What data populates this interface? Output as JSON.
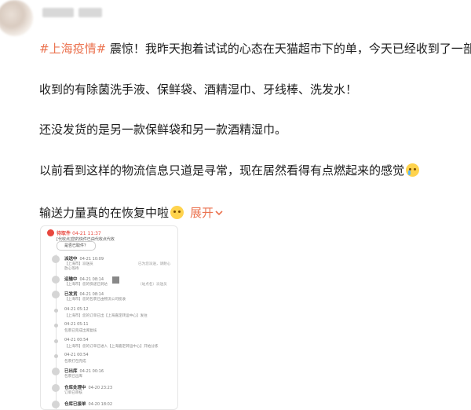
{
  "post": {
    "hashtag": "#上海疫情#",
    "line1_rest": " 震惊！我昨天抱着试试的心态在天猫超市下的单，今天已经收到了一部分",
    "line2": "收到的有除菌洗手液、保鲜袋、酒精湿巾、牙线棒、洗发水！",
    "line3": "还没发货的是另一款保鲜袋和另一款酒精湿巾。",
    "line4": "以前看到这样的物流信息只道是寻常，现在居然看得有点燃起来的感觉",
    "line5": "输送力量真的在恢复中啦",
    "expand_label": "展开",
    "expand_icon": "chevron-down-icon"
  },
  "tracking": {
    "status": "待取件",
    "status_time": "04-21 11:37",
    "status_note": "[代收点]您的快件已由代收点代收",
    "pickup_button": "是否已取件？",
    "events": [
      {
        "title": "派送中",
        "time": "04-21 10:09",
        "desc": "【上海市】派送员",
        "desc2": "放心等待",
        "right": "已为您派送，请耐心"
      },
      {
        "title": "运输中",
        "time": "04-21 08:14",
        "desc": "【上海市】您的快递已到达",
        "right": "（站点名）派送员"
      },
      {
        "title": "已发货",
        "time": "04-21 08:14",
        "desc": "【上海市】您的包裹已由物流公司揽收"
      },
      {
        "title": "",
        "time": "04-21 05:12",
        "desc": "【上海市】您的订单已出【上海嘉定转运中心】发往"
      },
      {
        "title": "",
        "time": "04-21 05:11",
        "desc": "包裹已完成出库复核"
      },
      {
        "title": "",
        "time": "04-21 00:54",
        "desc": "【上海市】您的订单已进入【上海嘉定转运中心】开始分拣"
      },
      {
        "title": "",
        "time": "04-21 00:54",
        "desc": "包裹打包完成"
      },
      {
        "title": "已出库",
        "time": "04-21 00:16",
        "desc": "包裹已出库"
      },
      {
        "title": "仓库处理中",
        "time": "04-20 23:23",
        "desc": "订单已审核"
      },
      {
        "title": "仓库已接单",
        "time": "04-20 18:02",
        "desc": ""
      }
    ]
  }
}
